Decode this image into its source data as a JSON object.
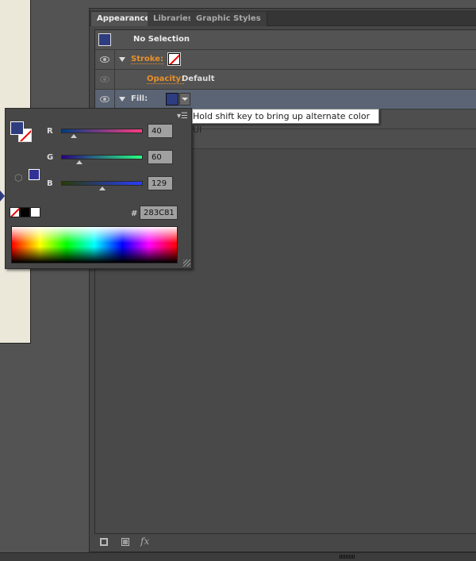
{
  "panel": {
    "tabs": [
      {
        "label": "Appearance"
      },
      {
        "label": "Libraries"
      },
      {
        "label": "Graphic Styles"
      }
    ],
    "header": "No Selection",
    "rows": {
      "stroke": "Stroke:",
      "opacity_label": "Opacity:",
      "opacity_value": "Default",
      "fill": "Fill:"
    }
  },
  "tooltip": "Hold shift key to bring up alternate color UI",
  "picker": {
    "channels": [
      {
        "label": "R",
        "value": "40",
        "fraction": 0.157
      },
      {
        "label": "G",
        "value": "60",
        "fraction": 0.235
      },
      {
        "label": "B",
        "value": "129",
        "fraction": 0.506
      }
    ],
    "hash": "#",
    "hex": "283C81"
  },
  "colors": {
    "fill": "#283C81",
    "accent": "#e8902a"
  },
  "footer": {
    "fx": "fx"
  }
}
